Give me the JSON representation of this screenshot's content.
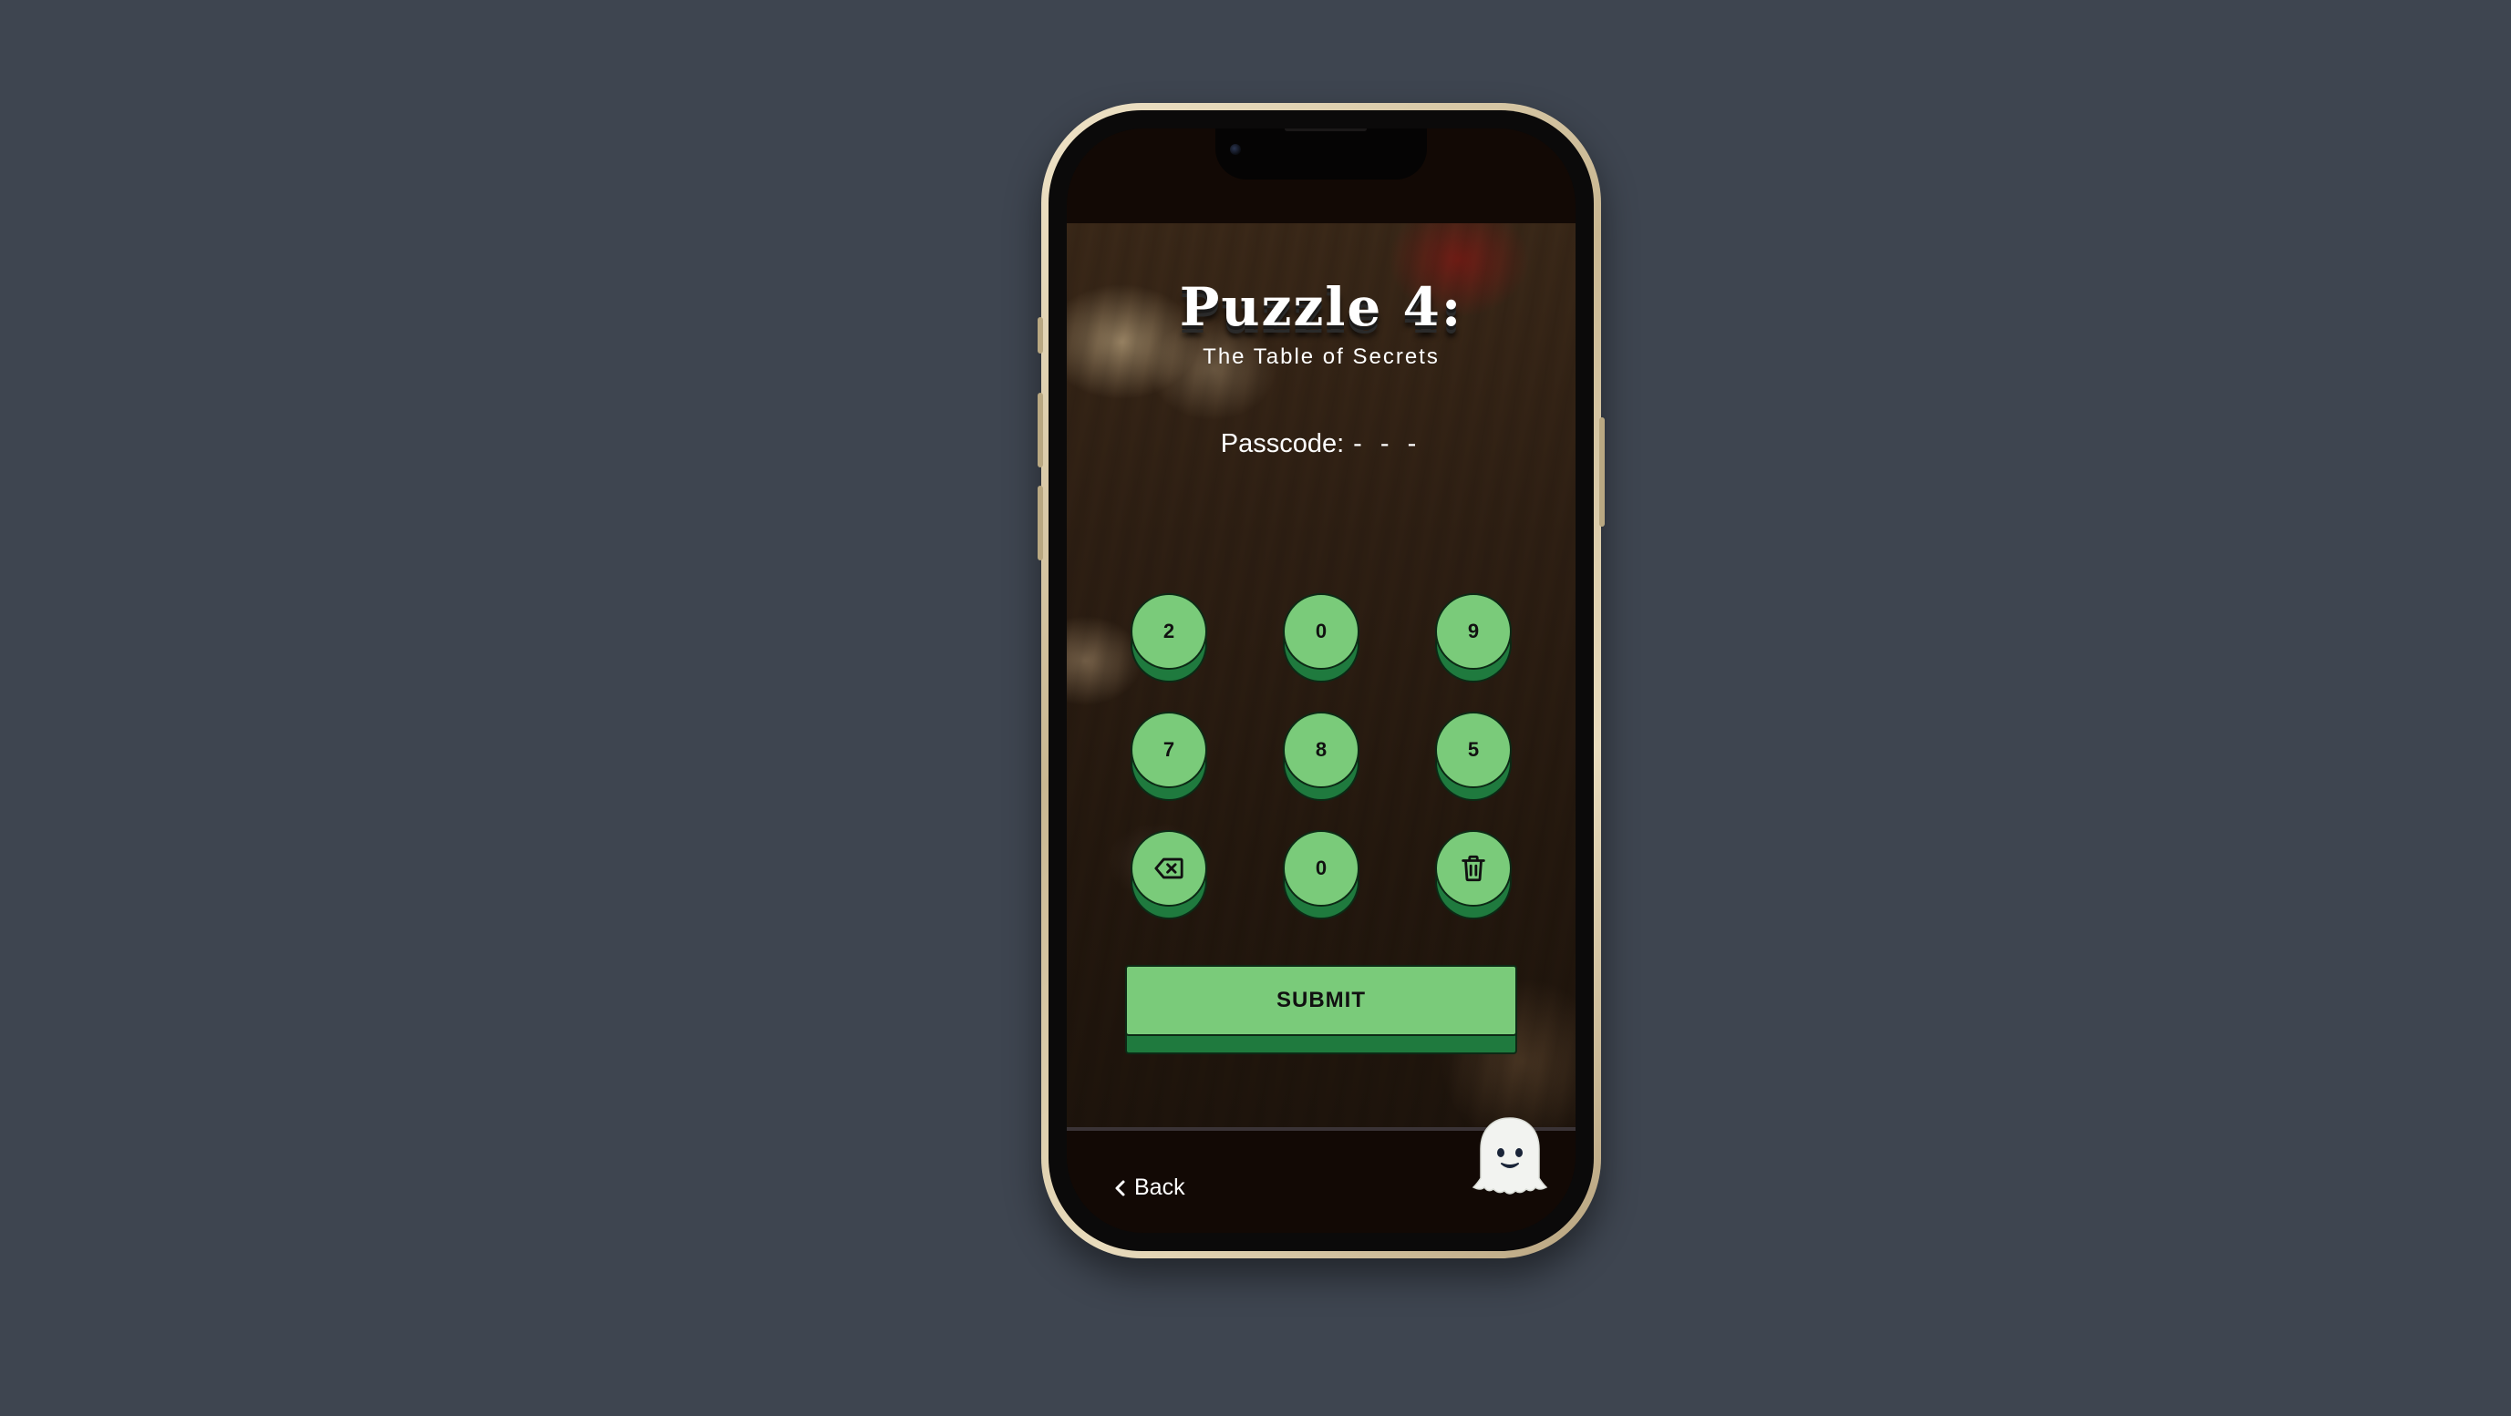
{
  "puzzle": {
    "title": "Puzzle 4:",
    "subtitle": "The Table of Secrets"
  },
  "passcode": {
    "label": "Passcode:",
    "display": "- - -"
  },
  "keypad": {
    "row1": [
      "2",
      "0",
      "9"
    ],
    "row2": [
      "7",
      "8",
      "5"
    ],
    "row3": {
      "backspace_icon": "backspace-icon",
      "middle": "0",
      "clear_icon": "trash-icon"
    }
  },
  "submit_label": "SUBMIT",
  "back_label": "Back",
  "mascot_icon": "ghost-icon",
  "colors": {
    "key_face": "#7acb7a",
    "key_base": "#1f7a3e",
    "page_background": "#3e4550"
  }
}
